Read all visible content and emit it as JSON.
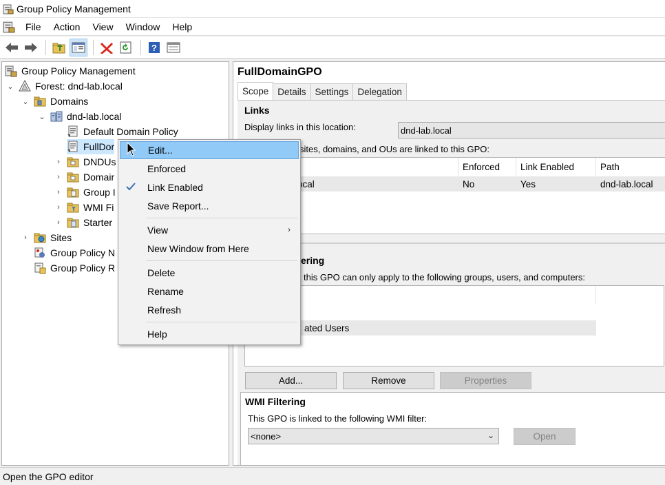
{
  "window": {
    "title": "Group Policy Management"
  },
  "menubar": {
    "items": [
      "File",
      "Action",
      "View",
      "Window",
      "Help"
    ]
  },
  "toolbar": {
    "buttons": [
      "back-icon",
      "forward-icon",
      "up-folder-icon",
      "show-hide-tree-icon",
      "delete-icon",
      "refresh-icon",
      "help-icon",
      "properties-icon"
    ]
  },
  "tree": {
    "root": "Group Policy Management",
    "forest": "Forest: dnd-lab.local",
    "domains": "Domains",
    "domain": "dnd-lab.local",
    "default_policy": "Default Domain Policy",
    "full_domain": "FullDor",
    "dndus": "DNDUs",
    "domain_controllers": "Domair",
    "group_policy_objects": "Group I",
    "wmi_filters": "WMI Fi",
    "starter_gpos": "Starter",
    "sites": "Sites",
    "modeling": "Group Policy N",
    "results": "Group Policy R"
  },
  "details": {
    "title": "FullDomainGPO",
    "tabs": [
      "Scope",
      "Details",
      "Settings",
      "Delegation"
    ],
    "links": {
      "heading": "Links",
      "display_label": "Display links in this location:",
      "location_value": "dnd-lab.local",
      "linked_text": "sites, domains, and OUs are linked to this GPO:",
      "columns": [
        "Enforced",
        "Link Enabled",
        "Path"
      ],
      "rows": [
        {
          "location": "ocal",
          "enforced": "No",
          "link_enabled": "Yes",
          "path": "dnd-lab.local"
        }
      ]
    },
    "security_filtering": {
      "heading": "ering",
      "description": "this GPO can only apply to the following groups, users, and computers:",
      "entries": [
        "ated Users"
      ]
    },
    "buttons": {
      "add": "Add...",
      "remove": "Remove",
      "properties": "Properties"
    },
    "wmi": {
      "heading": "WMI Filtering",
      "description": "This GPO is linked to the following WMI filter:",
      "value": "<none>",
      "open": "Open"
    }
  },
  "context_menu": {
    "items": [
      {
        "label": "Edit...",
        "highlighted": true
      },
      {
        "label": "Enforced"
      },
      {
        "label": "Link Enabled",
        "checked": true
      },
      {
        "label": "Save Report..."
      },
      {
        "label": "View",
        "submenu": true
      },
      {
        "label": "New Window from Here"
      },
      {
        "label": "Delete"
      },
      {
        "label": "Rename"
      },
      {
        "label": "Refresh"
      },
      {
        "label": "Help"
      }
    ]
  },
  "status": {
    "text": "Open the GPO editor"
  },
  "colors": {
    "highlight": "#91c9f7",
    "delete_red": "#d9261c",
    "help_blue": "#2c5fb3"
  }
}
